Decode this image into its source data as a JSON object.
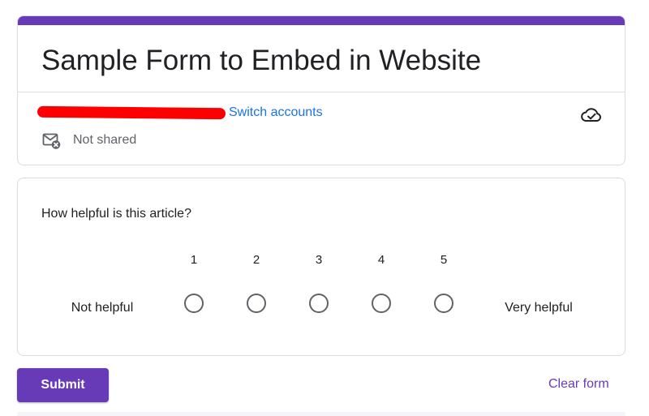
{
  "form": {
    "title": "Sample Form to Embed in Website",
    "accent_color": "#673ab7"
  },
  "account": {
    "email_redacted": true,
    "switch_label": "Switch accounts",
    "save_status_icon": "cloud-done-icon",
    "sharing_icon": "mail-not-shared-icon",
    "sharing_status": "Not shared"
  },
  "question": {
    "title": "How helpful is this article?",
    "scale": [
      {
        "label": "1",
        "selected": false
      },
      {
        "label": "2",
        "selected": false
      },
      {
        "label": "3",
        "selected": false
      },
      {
        "label": "4",
        "selected": false
      },
      {
        "label": "5",
        "selected": false
      }
    ],
    "low_label": "Not helpful",
    "high_label": "Very helpful"
  },
  "actions": {
    "submit_label": "Submit",
    "clear_label": "Clear form"
  }
}
